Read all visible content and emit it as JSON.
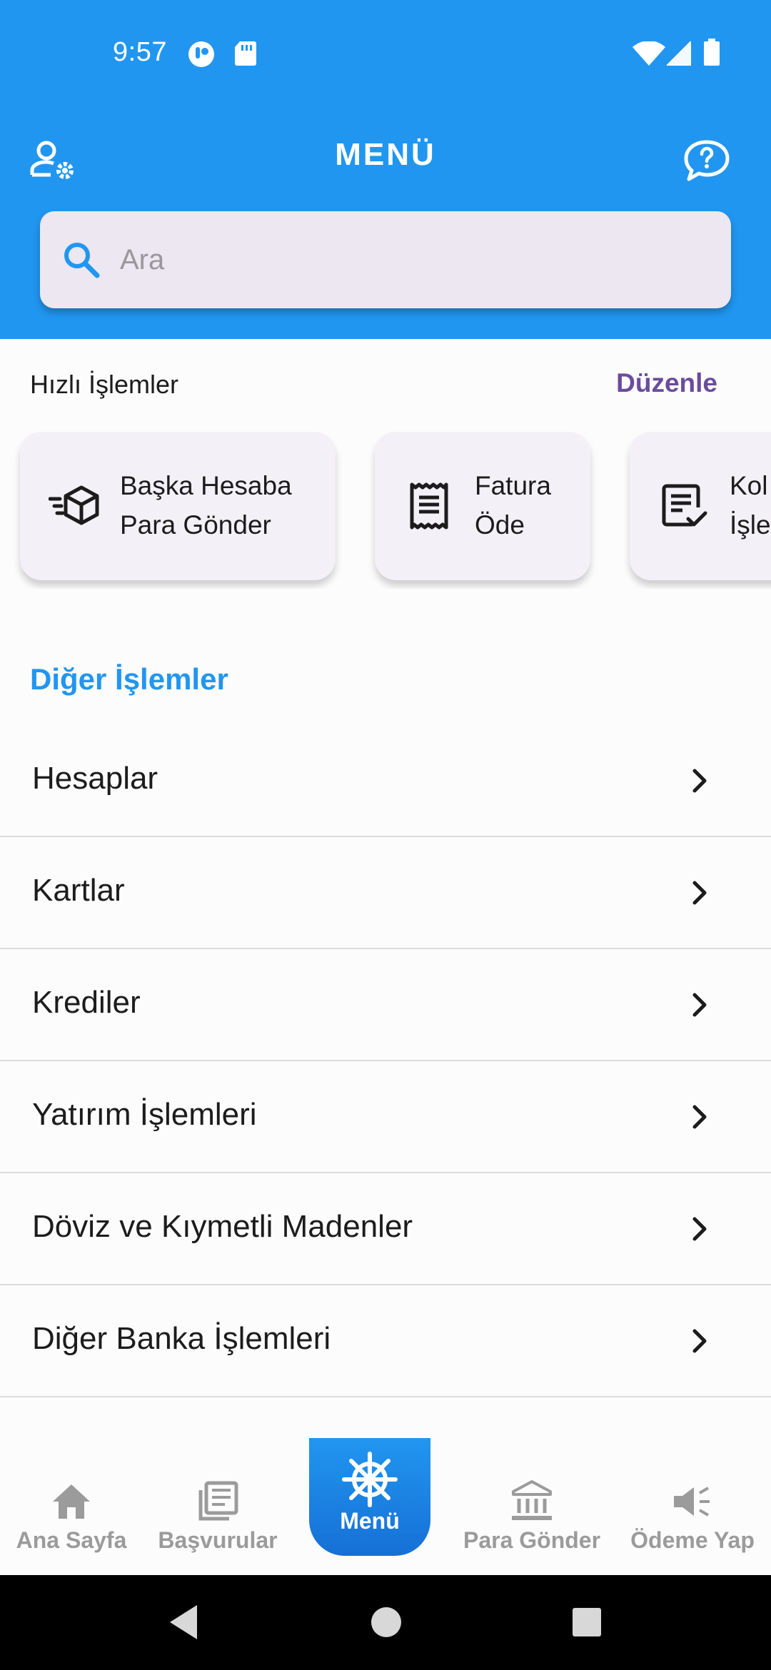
{
  "status_bar": {
    "time": "9:57"
  },
  "header": {
    "title": "MENÜ",
    "search_placeholder": "Ara"
  },
  "quick_actions": {
    "title": "Hızlı İşlemler",
    "edit_label": "Düzenle",
    "items": [
      {
        "label": "Başka Hesaba\nPara Gönder",
        "icon": "package-send-icon"
      },
      {
        "label": "Fatura\nÖde",
        "icon": "receipt-icon"
      },
      {
        "label": "Kol\nİşle",
        "icon": "document-check-icon"
      }
    ]
  },
  "other_actions": {
    "title": "Diğer İşlemler",
    "items": [
      {
        "label": "Hesaplar"
      },
      {
        "label": "Kartlar"
      },
      {
        "label": "Krediler"
      },
      {
        "label": "Yatırım İşlemleri"
      },
      {
        "label": "Döviz ve Kıymetli Madenler"
      },
      {
        "label": "Diğer Banka İşlemleri"
      }
    ]
  },
  "bottom_nav": {
    "items": [
      {
        "label": "Ana Sayfa",
        "icon": "home-icon"
      },
      {
        "label": "Başvurular",
        "icon": "applications-icon"
      },
      {
        "label": "Menü",
        "icon": "ship-wheel-icon",
        "active": true
      },
      {
        "label": "Para Gönder",
        "icon": "bank-icon"
      },
      {
        "label": "Ödeme Yap",
        "icon": "megaphone-icon"
      }
    ]
  },
  "colors": {
    "primary": "#2196f0",
    "edit_accent": "#6a4c9c",
    "card_bg": "#f4f0f7",
    "search_bg": "#ece7f0"
  }
}
